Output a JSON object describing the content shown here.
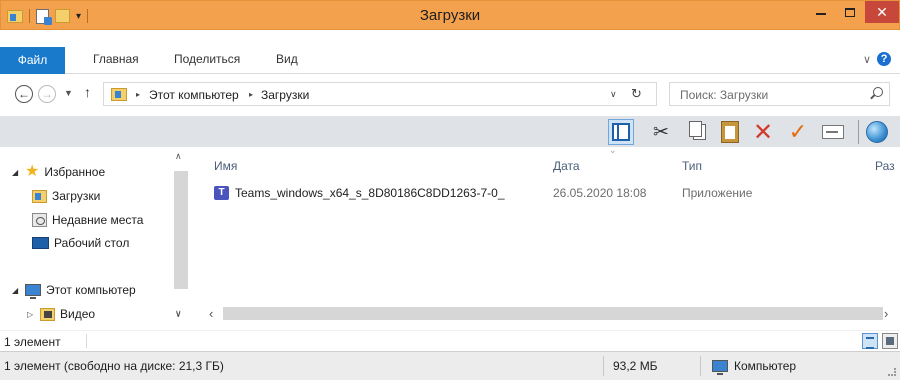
{
  "window": {
    "title": "Загрузки",
    "close_glyph": "✕"
  },
  "ribbon": {
    "file_tab": "Файл",
    "tabs": [
      "Главная",
      "Поделиться",
      "Вид"
    ],
    "expand_glyph": "∨",
    "help_glyph": "?"
  },
  "address": {
    "breadcrumbs": [
      "Этот компьютер",
      "Загрузки"
    ],
    "separator": "▸"
  },
  "search": {
    "placeholder": "Поиск: Загрузки"
  },
  "nav_pane": {
    "favorites": "Избранное",
    "downloads": "Загрузки",
    "recent": "Недавние места",
    "desktop": "Рабочий стол",
    "this_pc": "Этот компьютер",
    "videos": "Видео"
  },
  "columns": {
    "name": "Имя",
    "date": "Дата",
    "type": "Тип",
    "size": "Раз"
  },
  "files": [
    {
      "name": "Teams_windows_x64_s_8D80186C8DD1263-7-0_",
      "date": "26.05.2020 18:08",
      "type": "Приложение",
      "icon": "teams-icon"
    }
  ],
  "status_line": {
    "item_count": "1 элемент"
  },
  "status_bar": {
    "free_space": "1 элемент (свободно на диске: 21,3 ГБ)",
    "size": "93,2 МБ",
    "location": "Компьютер"
  },
  "colors": {
    "titlebar": "#f4a14d",
    "file_tab": "#1979ca",
    "close_button": "#c7473a",
    "toolstrip": "#dfe3e8"
  }
}
